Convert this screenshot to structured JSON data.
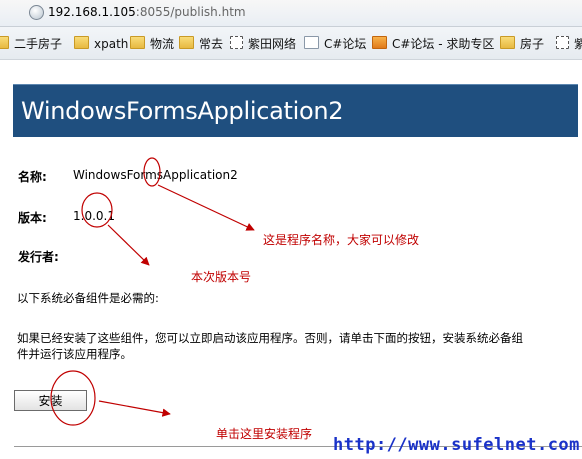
{
  "address_bar": {
    "url_host": "192.168.1.105",
    "url_rest": ":8055/publish.htm"
  },
  "bookmarks": [
    {
      "label": "二手房子",
      "icon": "folder-icon"
    },
    {
      "label": "xpath",
      "icon": "folder-icon"
    },
    {
      "label": "物流",
      "icon": "folder-icon"
    },
    {
      "label": "常去",
      "icon": "folder-icon"
    },
    {
      "label": "紫田网络",
      "icon": "page-icon"
    },
    {
      "label": "C#论坛",
      "icon": "net-icon"
    },
    {
      "label": "C#论坛 - 求助专区",
      "icon": "rss-icon"
    },
    {
      "label": "房子",
      "icon": "folder-icon"
    },
    {
      "label": "紫",
      "icon": "page-icon"
    }
  ],
  "page": {
    "app_title": "WindowsFormsApplication2",
    "name_label": "名称:",
    "name_value": "WindowsFormsApplication2",
    "version_label": "版本:",
    "version_value": "1.0.0.1",
    "publisher_label": "发行者:",
    "publisher_value": "",
    "prereq_text": "以下系统必备组件是必需的:",
    "instruction_line1": "如果已经安装了这些组件，您可以立即启动该应用程序。否则，请单击下面的按钮，安装系统必备组",
    "instruction_line2": "件并运行该应用程序。",
    "install_button": "安装"
  },
  "annotations": {
    "name_note": "这是程序名称，大家可以修改",
    "version_note": "本次版本号",
    "install_note": "单击这里安装程序",
    "annotation_color": "#c00000"
  },
  "watermark": "http://www.sufelnet.com",
  "colors": {
    "header_bg": "#1f4f7f",
    "watermark": "#1a32c8"
  }
}
